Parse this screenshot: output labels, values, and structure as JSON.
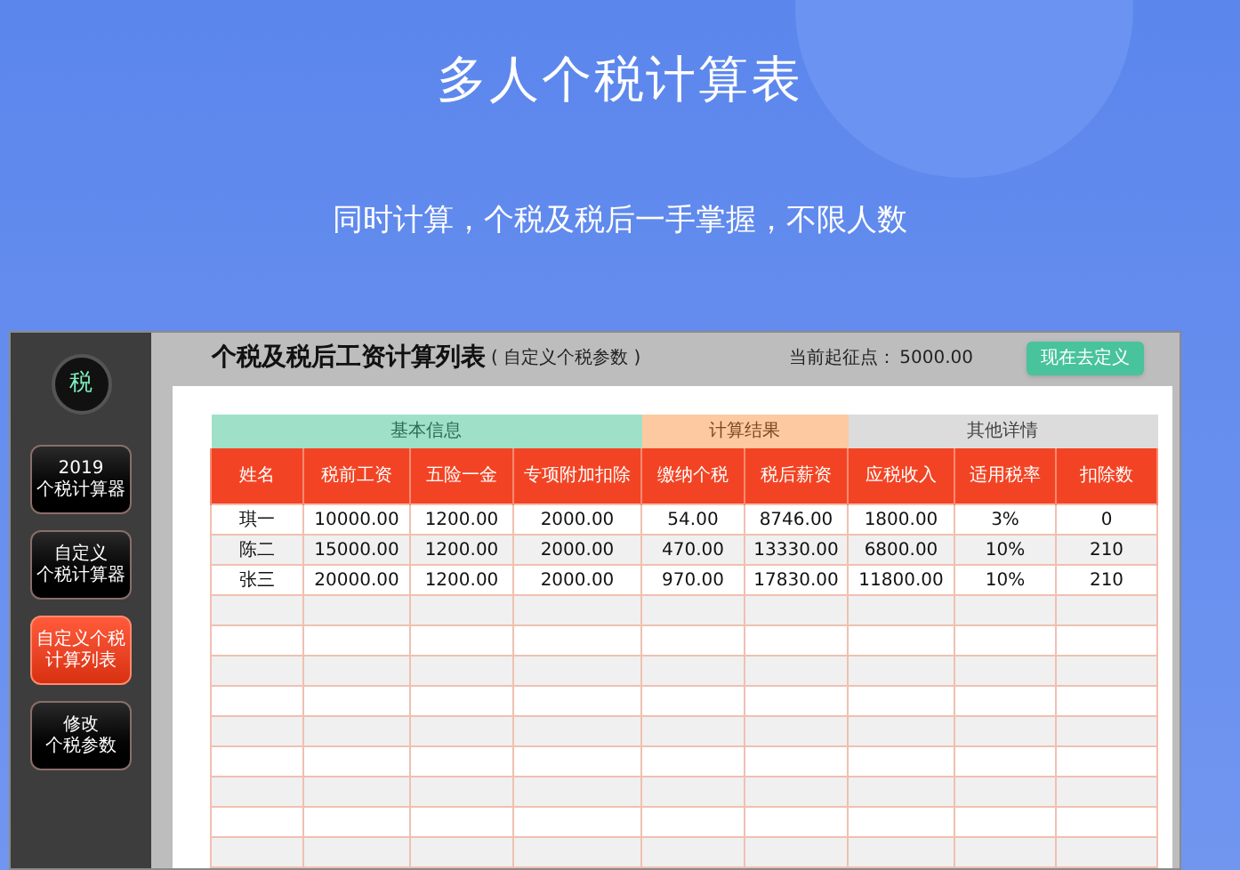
{
  "banner": {
    "title": "多人个税计算表",
    "subtitle": "同时计算，个税及税后一手掌握，不限人数"
  },
  "sidebar": {
    "logo": "税",
    "items": [
      {
        "lines": [
          "2019",
          "个税计算器"
        ],
        "selected": false
      },
      {
        "lines": [
          "自定义",
          "个税计算器"
        ],
        "selected": false
      },
      {
        "lines": [
          "自定义个税",
          "计算列表"
        ],
        "selected": true
      },
      {
        "lines": [
          "修改",
          "个税参数"
        ],
        "selected": false
      }
    ]
  },
  "header": {
    "title": "个税及税后工资计算列表",
    "subtitle": "( 自定义个税参数 )",
    "threshold_label": "当前起征点：",
    "threshold_value": "5000.00",
    "button": "现在去定义"
  },
  "table": {
    "groups": [
      {
        "label": "基本信息",
        "kind": "basic",
        "columns": [
          "姓名",
          "税前工资",
          "五险一金",
          "专项附加扣除"
        ]
      },
      {
        "label": "计算结果",
        "kind": "result",
        "columns": [
          "缴纳个税",
          "税后薪资"
        ]
      },
      {
        "label": "其他详情",
        "kind": "other",
        "columns": [
          "应税收入",
          "适用税率",
          "扣除数"
        ]
      }
    ],
    "rows": [
      [
        "琪一",
        "10000.00",
        "1200.00",
        "2000.00",
        "54.00",
        "8746.00",
        "1800.00",
        "3%",
        "0"
      ],
      [
        "陈二",
        "15000.00",
        "1200.00",
        "2000.00",
        "470.00",
        "13330.00",
        "6800.00",
        "10%",
        "210"
      ],
      [
        "张三",
        "20000.00",
        "1200.00",
        "2000.00",
        "970.00",
        "17830.00",
        "11800.00",
        "10%",
        "210"
      ]
    ]
  }
}
